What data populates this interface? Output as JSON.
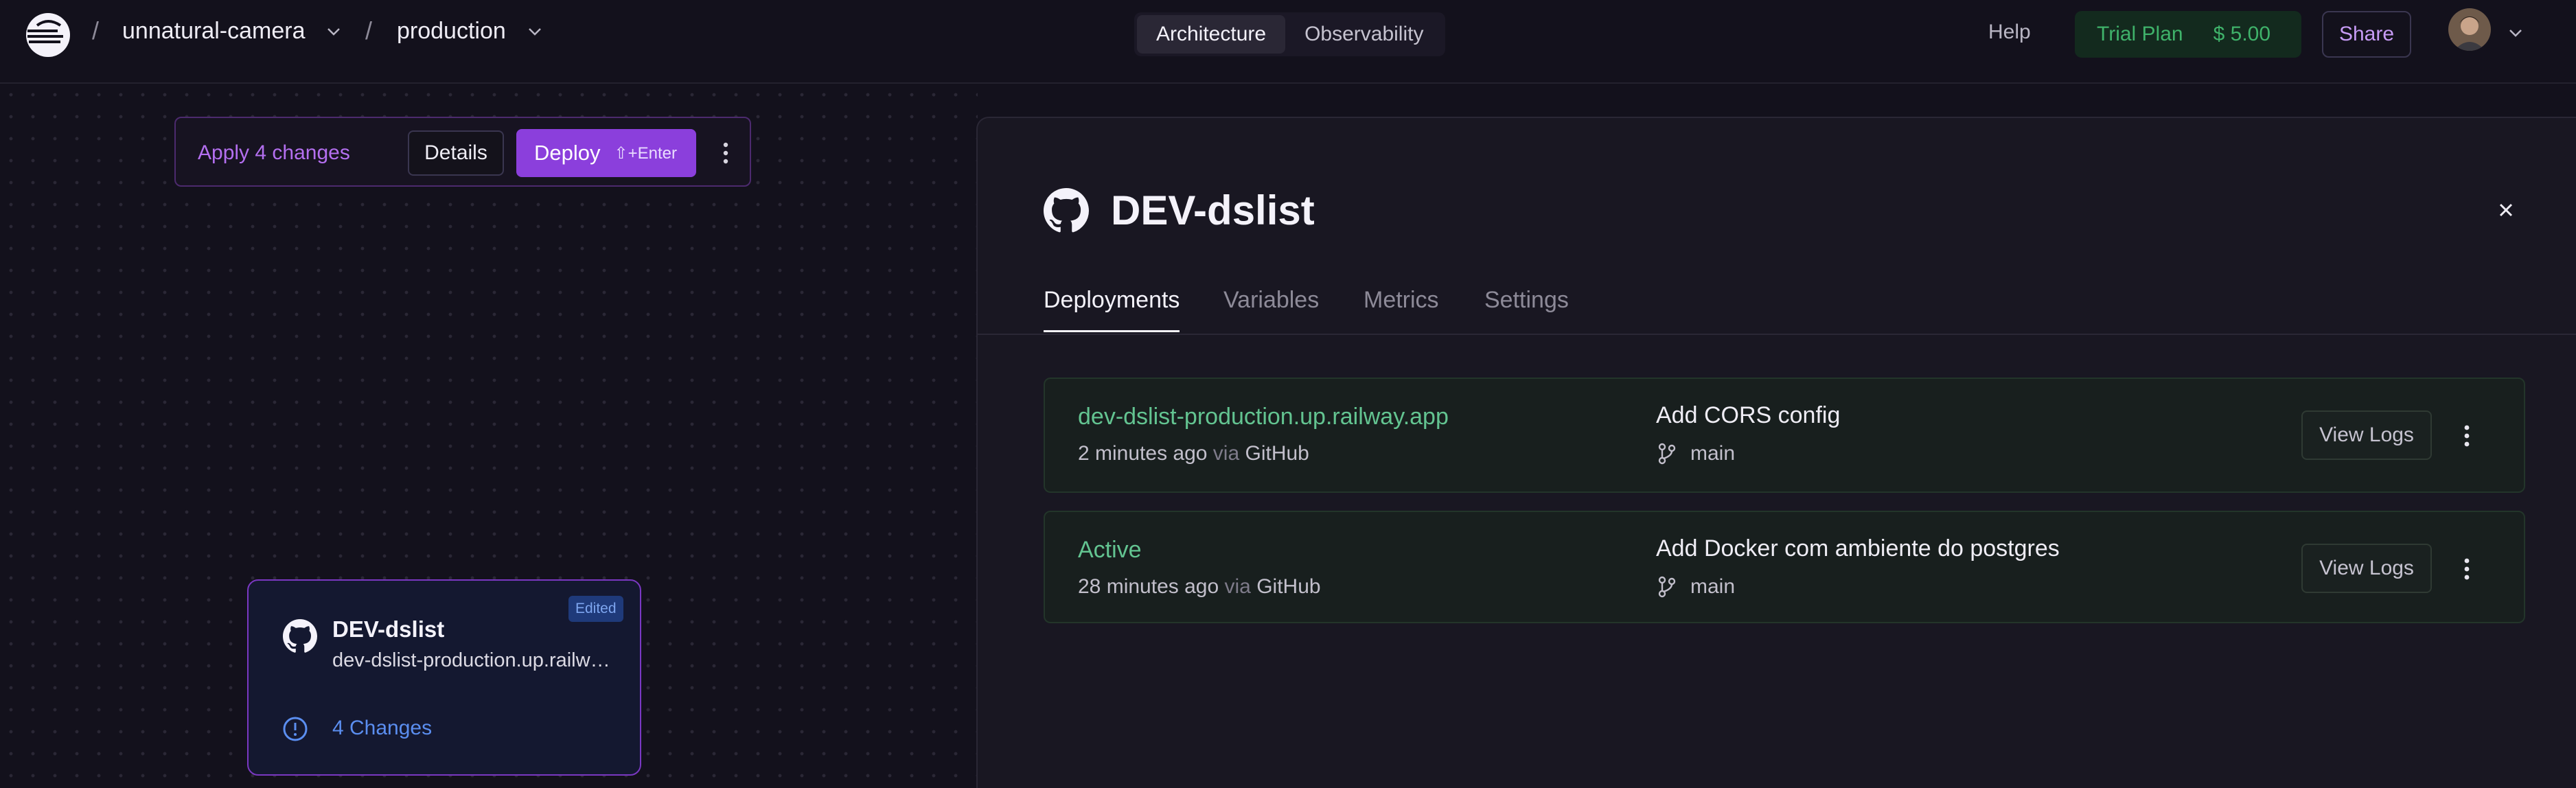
{
  "header": {
    "project": "unnatural-camera",
    "environment": "production",
    "separator": "/",
    "tabs": [
      "Architecture",
      "Observability"
    ],
    "active_tab": "Architecture",
    "help": "Help",
    "plan": "Trial Plan",
    "credit": "$ 5.00",
    "share": "Share"
  },
  "apply_bar": {
    "text": "Apply 4 changes",
    "details": "Details",
    "deploy": "Deploy",
    "shortcut": "⇧+Enter"
  },
  "service_card": {
    "name": "DEV-dslist",
    "url": "dev-dslist-production.up.railway.app",
    "badge": "Edited",
    "changes": "4 Changes"
  },
  "panel": {
    "title": "DEV-dslist",
    "tabs": [
      "Deployments",
      "Variables",
      "Metrics",
      "Settings"
    ],
    "active_tab": "Deployments",
    "deployments": [
      {
        "status": "dev-dslist-production.up.railway.app",
        "time": "2 minutes ago",
        "via": "via",
        "source": "GitHub",
        "message": "Add CORS config",
        "branch": "main",
        "action": "View Logs"
      },
      {
        "status": "Active",
        "time": "28 minutes ago",
        "via": "via",
        "source": "GitHub",
        "message": "Add Docker com ambiente do postgres",
        "branch": "main",
        "action": "View Logs"
      }
    ]
  },
  "colors": {
    "accent_purple": "#8b3fdc",
    "success_green": "#63c491",
    "info_blue": "#5b8ef0"
  },
  "icons": [
    "railway-logo-icon",
    "chevron-down-icon",
    "github-icon",
    "close-icon",
    "git-branch-icon",
    "more-vertical-icon",
    "info-circle-icon"
  ]
}
